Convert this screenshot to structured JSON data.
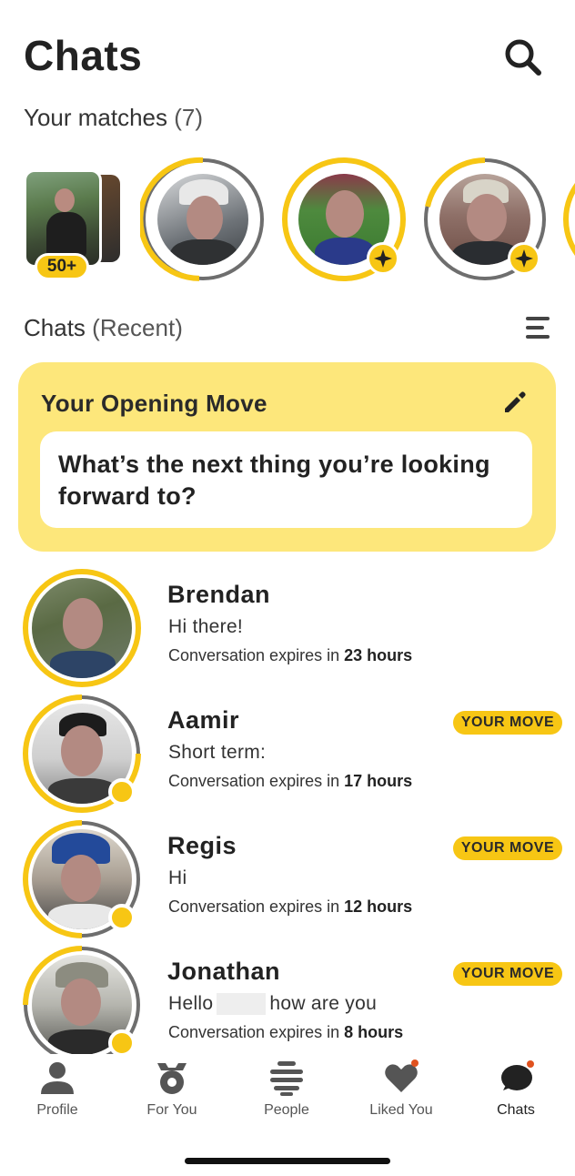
{
  "header": {
    "title": "Chats",
    "search_icon": "search-icon"
  },
  "matches": {
    "label": "Your matches",
    "count": "(7)",
    "queue_badge": "50+",
    "profiles": [
      {
        "name": "match-1",
        "expiry_fraction": 0.6
      },
      {
        "name": "match-2",
        "expiry_fraction": 0.85,
        "badge": "+"
      },
      {
        "name": "match-3",
        "expiry_fraction": 0.45,
        "badge": "+"
      }
    ]
  },
  "chats_section": {
    "label": "Chats",
    "sublabel": "(Recent)",
    "filter_icon": "filter-lines-icon"
  },
  "opening_move": {
    "title": "Your Opening Move",
    "question": "What’s the next thing you’re looking forward to?",
    "edit_icon": "pencil-icon"
  },
  "conversations": [
    {
      "name": "Brendan",
      "message": "Hi there!",
      "expiry_prefix": "Conversation expires in",
      "expiry_value": "23 hours",
      "badge": ""
    },
    {
      "name": "Aamir",
      "message": "Short term:",
      "expiry_prefix": "Conversation expires in",
      "expiry_value": "17 hours",
      "badge": "YOUR MOVE"
    },
    {
      "name": "Regis",
      "message": "Hi",
      "expiry_prefix": "Conversation expires in",
      "expiry_value": "12 hours",
      "badge": "YOUR MOVE"
    },
    {
      "name": "Jonathan",
      "message_start": "Hello",
      "message_end": "how are you",
      "expiry_prefix": "Conversation expires in",
      "expiry_value": "8 hours",
      "badge": "YOUR MOVE"
    }
  ],
  "nav": [
    {
      "label": "Profile",
      "icon": "person-icon"
    },
    {
      "label": "For You",
      "icon": "for-you-icon"
    },
    {
      "label": "People",
      "icon": "people-icon"
    },
    {
      "label": "Liked You",
      "icon": "heart-icon"
    },
    {
      "label": "Chats",
      "icon": "chat-bubble-icon",
      "active": true
    }
  ],
  "colors": {
    "accent": "#f7c614",
    "card": "#fde77b",
    "ring_gray": "#6e6e6e"
  }
}
